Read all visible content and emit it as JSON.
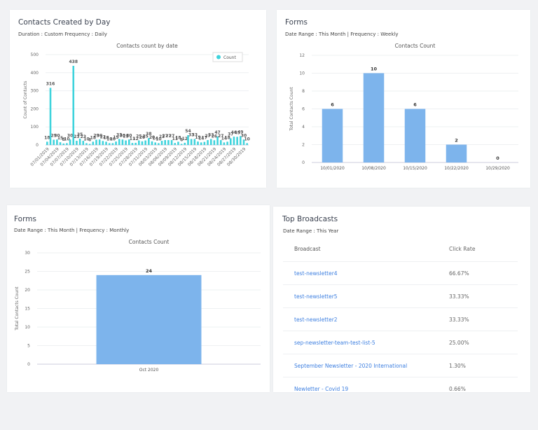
{
  "colors": {
    "teal": "#3ed3dc",
    "blue": "#7db4ec",
    "link": "#3d7fe0"
  },
  "contacts_card": {
    "title": "Contacts Created by Day",
    "subtitle": "Duration : Custom Frequency : Daily"
  },
  "forms_weekly": {
    "title": "Forms",
    "subtitle": "Date Range : This Month | Frequency : Weekly"
  },
  "forms_monthly": {
    "title": "Forms",
    "subtitle": "Date Range : This Month | Frequency : Monthly"
  },
  "broadcasts": {
    "title": "Top Broadcasts",
    "subtitle": "Date Range : This Year",
    "headers": [
      "Broadcast",
      "Click Rate"
    ],
    "rows": [
      [
        "test-newsletter4",
        "66.67%"
      ],
      [
        "test-newsletter5",
        "33.33%"
      ],
      [
        "test-newsletter2",
        "33.33%"
      ],
      [
        "sep-newsletter-team-test-list-5",
        "25.00%"
      ],
      [
        "September Newsletter - 2020 International",
        "1.30%"
      ],
      [
        "Newletter - Covid 19",
        "0.66%"
      ]
    ]
  },
  "chart_data": [
    {
      "type": "bar",
      "title": "Contacts count by date",
      "ylabel": "Count of Contacts",
      "ylim": [
        0,
        500
      ],
      "yticks": [
        0,
        100,
        200,
        300,
        400,
        500
      ],
      "legend": "top-right",
      "series": [
        {
          "name": "Count",
          "values": [
            18,
            316,
            29,
            30,
            15,
            8,
            10,
            30,
            438,
            23,
            35,
            23,
            10,
            6,
            18,
            29,
            30,
            22,
            18,
            10,
            10,
            19,
            33,
            30,
            25,
            30,
            11,
            12,
            25,
            20,
            25,
            38,
            20,
            14,
            10,
            23,
            27,
            27,
            27,
            11,
            18,
            6,
            12,
            54,
            33,
            33,
            19,
            14,
            17,
            27,
            33,
            26,
            47,
            27,
            14,
            18,
            37,
            46,
            45,
            49,
            30,
            10
          ]
        }
      ],
      "x_start": "07/01/2019",
      "x_end": "08/31/2019",
      "tick_labels": [
        "07/01/2019",
        "07/04/2019",
        "07/07/2019",
        "07/10/2019",
        "07/13/2019",
        "07/16/2019",
        "07/19/2019",
        "07/22/2019",
        "07/25/2019",
        "07/28/2019",
        "07/31/2019",
        "08/03/2019",
        "08/06/2019",
        "08/09/2019",
        "08/12/2019",
        "08/15/2019",
        "08/18/2019",
        "08/21/2019",
        "08/24/2019",
        "08/27/2019",
        "08/30/2019"
      ],
      "grid": true
    },
    {
      "type": "bar",
      "title": "Contacts Count",
      "ylabel": "Total Contacts Count",
      "ylim": [
        0,
        12
      ],
      "yticks": [
        0,
        2,
        4,
        6,
        8,
        10,
        12
      ],
      "categories": [
        "10/01/2020",
        "10/08/2020",
        "10/15/2020",
        "10/22/2020",
        "10/29/2020"
      ],
      "values": [
        6,
        10,
        6,
        2,
        0
      ],
      "grid": true
    },
    {
      "type": "bar",
      "title": "Contacts Count",
      "ylabel": "Total Contacts Count",
      "ylim": [
        0,
        30
      ],
      "yticks": [
        0,
        5,
        10,
        15,
        20,
        25,
        30
      ],
      "categories": [
        "Oct 2020"
      ],
      "values": [
        24
      ],
      "grid": true
    }
  ]
}
